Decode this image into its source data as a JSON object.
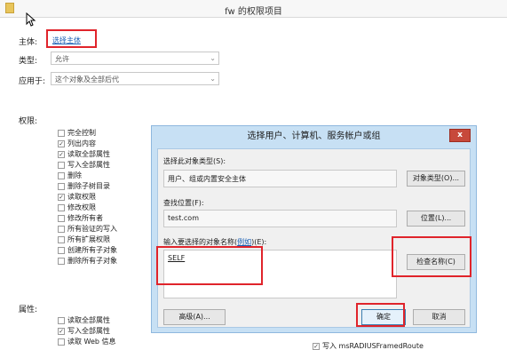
{
  "window": {
    "title": "fw 的权限项目"
  },
  "principal": {
    "label": "主体:",
    "link": "选择主体"
  },
  "type": {
    "label": "类型:",
    "value": "允许"
  },
  "applies_to": {
    "label": "应用于:",
    "value": "这个对象及全部后代"
  },
  "permissions": {
    "label": "权限:",
    "items": [
      {
        "label": "完全控制",
        "checked": false
      },
      {
        "label": "列出内容",
        "checked": true
      },
      {
        "label": "读取全部属性",
        "checked": true
      },
      {
        "label": "写入全部属性",
        "checked": false
      },
      {
        "label": "删除",
        "checked": false
      },
      {
        "label": "删除子树目录",
        "checked": false
      },
      {
        "label": "读取权限",
        "checked": true
      },
      {
        "label": "修改权限",
        "checked": false
      },
      {
        "label": "修改所有者",
        "checked": false
      },
      {
        "label": "所有验证的写入",
        "checked": false
      },
      {
        "label": "所有扩展权限",
        "checked": false
      },
      {
        "label": "创建所有子对象",
        "checked": false
      },
      {
        "label": "删除所有子对象",
        "checked": false
      }
    ]
  },
  "properties": {
    "label": "属性:",
    "items": [
      {
        "label": "读取全部属性",
        "checked": false
      },
      {
        "label": "写入全部属性",
        "checked": true
      },
      {
        "label": "读取 Web 信息",
        "checked": false
      }
    ],
    "right_item": {
      "label": "写入 msRADIUSFramedRoute",
      "checked": true
    }
  },
  "dialog": {
    "title": "选择用户、计算机、服务帐户或组",
    "close": "x",
    "object_type_label": "选择此对象类型(S):",
    "object_type_value": "用户、组或内置安全主体",
    "object_type_button": "对象类型(O)...",
    "location_label": "查找位置(F):",
    "location_value": "test.com",
    "location_button": "位置(L)...",
    "names_label_prefix": "输入要选择的对象名称(",
    "names_label_link": "例如",
    "names_label_suffix": ")(E):",
    "names_value": "SELF",
    "check_names_button": "检查名称(C)",
    "advanced_button": "高级(A)...",
    "ok_button": "确定",
    "cancel_button": "取消"
  },
  "icons": [
    "folder-icon",
    "cursor-icon",
    "close-icon",
    "dropdown-arrow-icon",
    "checkbox-icon"
  ]
}
